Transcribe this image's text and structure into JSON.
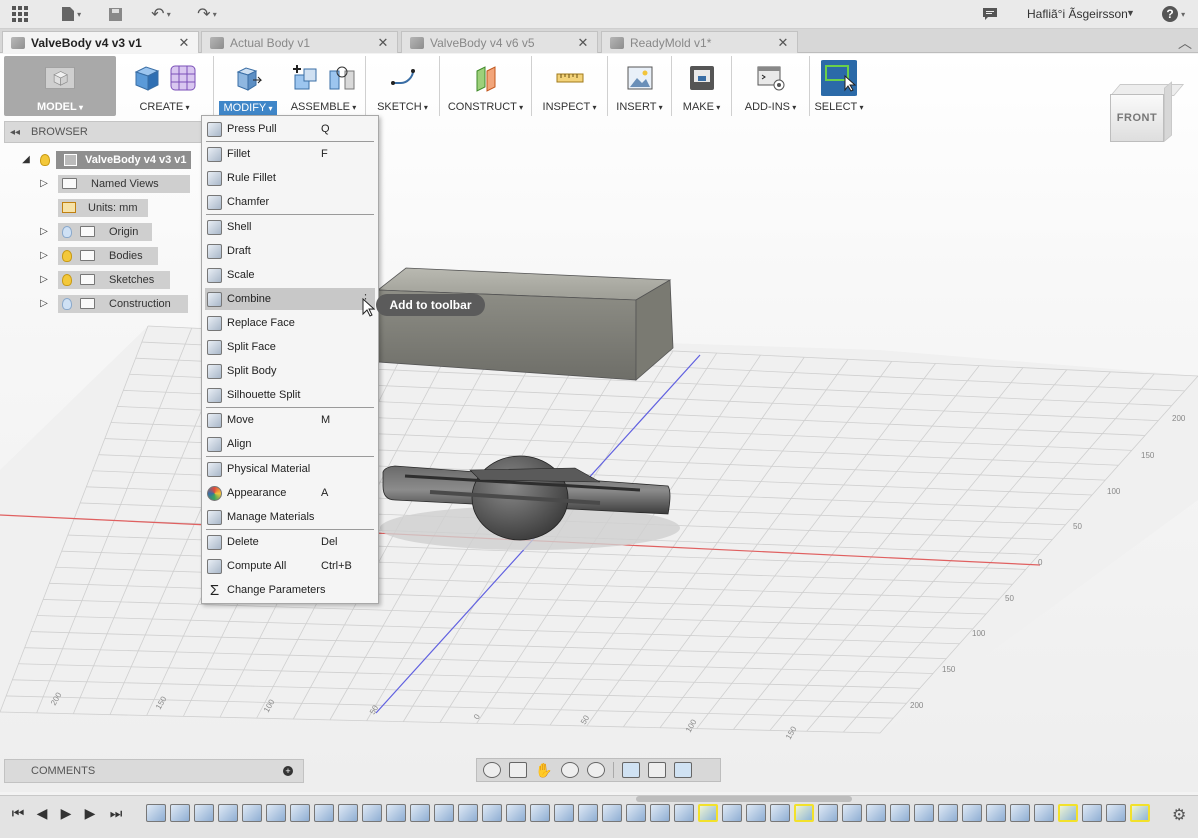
{
  "app": {
    "user_name": "Hafliã°i Ãsgeirsson",
    "icons": [
      "apps-grid-icon",
      "file-icon",
      "save-icon",
      "undo-icon",
      "redo-icon",
      "notifications-icon",
      "help-icon"
    ]
  },
  "tabs": [
    {
      "label": "ValveBody v4 v3 v1",
      "active": true
    },
    {
      "label": "Actual Body v1",
      "active": false
    },
    {
      "label": "ValveBody v4 v6 v5",
      "active": false
    },
    {
      "label": "ReadyMold v1*",
      "active": false
    }
  ],
  "toolbar": {
    "workspace": "MODEL",
    "groups": [
      {
        "label": "CREATE"
      },
      {
        "label": "MODIFY",
        "active": true
      },
      {
        "label": "ASSEMBLE"
      },
      {
        "label": "SKETCH"
      },
      {
        "label": "CONSTRUCT"
      },
      {
        "label": "INSPECT"
      },
      {
        "label": "INSERT"
      },
      {
        "label": "MAKE"
      },
      {
        "label": "ADD-INS"
      },
      {
        "label": "SELECT"
      }
    ]
  },
  "browser": {
    "title": "BROWSER",
    "root": "ValveBody v4 v3 v1",
    "items": [
      {
        "label": "Named Views"
      },
      {
        "label": "Units: mm"
      },
      {
        "label": "Origin"
      },
      {
        "label": "Bodies"
      },
      {
        "label": "Sketches"
      },
      {
        "label": "Construction"
      }
    ]
  },
  "modify_menu": {
    "items": [
      {
        "label": "Press Pull",
        "key": "Q"
      },
      {
        "label": "Fillet",
        "key": "F"
      },
      {
        "label": "Rule Fillet",
        "key": ""
      },
      {
        "label": "Chamfer",
        "key": ""
      },
      {
        "label": "Shell",
        "key": ""
      },
      {
        "label": "Draft",
        "key": ""
      },
      {
        "label": "Scale",
        "key": ""
      },
      {
        "label": "Combine",
        "key": "",
        "hover": true
      },
      {
        "label": "Replace Face",
        "key": ""
      },
      {
        "label": "Split Face",
        "key": ""
      },
      {
        "label": "Split Body",
        "key": ""
      },
      {
        "label": "Silhouette Split",
        "key": ""
      },
      {
        "label": "Move",
        "key": "M"
      },
      {
        "label": "Align",
        "key": ""
      },
      {
        "label": "Physical Material",
        "key": ""
      },
      {
        "label": "Appearance",
        "key": "A"
      },
      {
        "label": "Manage Materials",
        "key": ""
      },
      {
        "label": "Delete",
        "key": "Del"
      },
      {
        "label": "Compute All",
        "key": "Ctrl+B"
      },
      {
        "label": "Change Parameters",
        "key": ""
      }
    ]
  },
  "tooltip": "Add to toolbar",
  "viewcube": {
    "face": "FRONT"
  },
  "grid_labels": [
    "200",
    "150",
    "100",
    "50",
    "0",
    "50",
    "100",
    "150",
    "200",
    "150",
    "100",
    "50",
    "0",
    "50",
    "100",
    "150",
    "200"
  ],
  "comments": {
    "title": "COMMENTS"
  },
  "colors": {
    "accent": "#3f86c8",
    "axis_red": "#e06060",
    "axis_blue": "#6060e0",
    "highlight": "#f2e12b"
  }
}
